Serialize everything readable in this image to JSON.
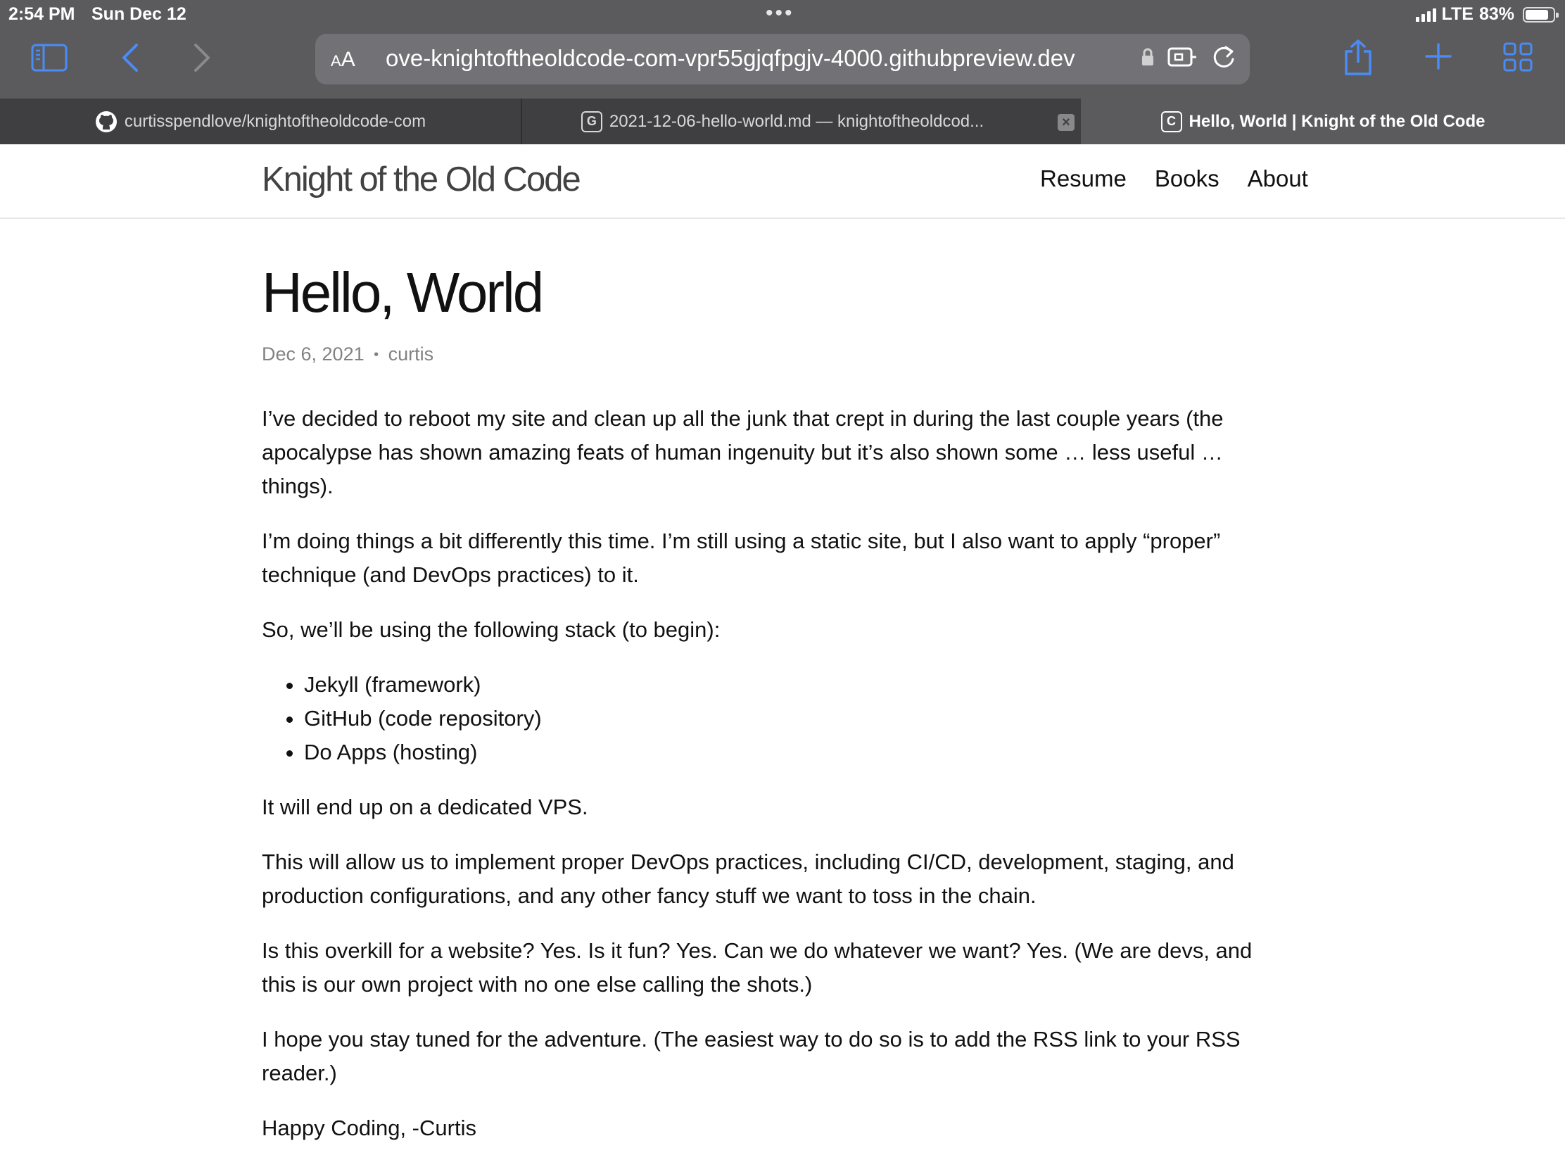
{
  "status": {
    "time": "2:54 PM",
    "date": "Sun Dec 12",
    "network": "LTE",
    "battery": "83%",
    "battery_level": 0.83
  },
  "browser": {
    "text_size_label": "AA",
    "url": "ove-knightoftheoldcode-com-vpr55gjqfpgjv-4000.githubpreview.dev",
    "tabs": [
      {
        "title": "curtisspendlove/knightoftheoldcode-com",
        "favicon": "github-icon"
      },
      {
        "title": "2021-12-06-hello-world.md — knightoftheoldcod...",
        "favicon": "G"
      },
      {
        "title": "Hello, World | Knight of the Old Code",
        "favicon": "C"
      }
    ]
  },
  "site": {
    "title": "Knight of the Old Code",
    "nav": [
      "Resume",
      "Books",
      "About"
    ]
  },
  "post": {
    "title": "Hello, World",
    "date": "Dec 6, 2021",
    "separator": "•",
    "author": "curtis",
    "p1": "I’ve decided to reboot my site and clean up all the junk that crept in during the last couple years (the apocalypse has shown amazing feats of human ingenuity but it’s also shown some … less useful … things).",
    "p2": "I’m doing things a bit differently this time. I’m still using a static site, but I also want to apply “proper” technique (and DevOps practices) to it.",
    "p3": "So, we’ll be using the following stack (to begin):",
    "stack": [
      "Jekyll (framework)",
      "GitHub (code repository)",
      "Do Apps (hosting)"
    ],
    "p4": "It will end up on a dedicated VPS.",
    "p5": "This will allow us to implement proper DevOps practices, including CI/CD, development, staging, and production configurations, and any other fancy stuff we want to toss in the chain.",
    "p6": "Is this overkill for a website? Yes. Is it fun? Yes. Can we do whatever we want? Yes. (We are devs, and this is our own project with no one else calling the shots.)",
    "p7": "I hope you stay tuned for the adventure. (The easiest way to do so is to add the RSS link to your RSS reader.)",
    "p8": "Happy Coding, -Curtis"
  },
  "colors": {
    "chrome": "#5b5b5e",
    "tabbar": "#3f3f42",
    "accent": "#4a8cf7"
  }
}
